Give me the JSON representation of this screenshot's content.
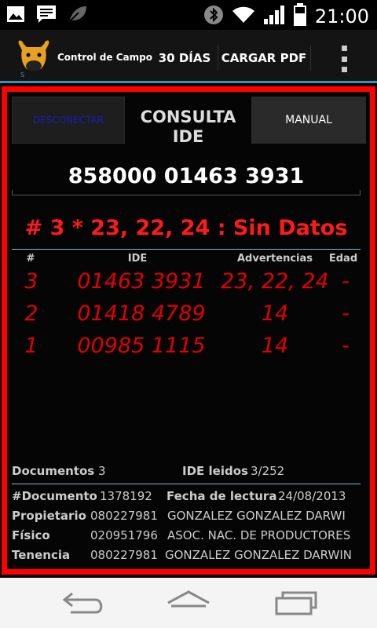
{
  "status_bar": {
    "time": "21:00",
    "icons": [
      "image-icon",
      "message-icon",
      "leaf-icon",
      "bluetooth-icon",
      "wifi-icon",
      "signal-icon",
      "battery-icon"
    ]
  },
  "action_bar": {
    "title": "Control de Campo",
    "btn_30_dias": "30 DÍAS",
    "btn_cargar_pdf": "CARGAR PDF"
  },
  "main": {
    "btn_desconectar": "DESCONECTAR",
    "consulta_line1": "CONSULTA",
    "consulta_line2": "IDE",
    "btn_manual": "MANUAL",
    "ide_value": "858000 01463 3931",
    "result": "# 3 * 23, 22, 24 : Sin Datos",
    "table": {
      "headers": [
        "#",
        "IDE",
        "Advertencias",
        "Edad"
      ],
      "rows": [
        {
          "num": "3",
          "ide": "01463 3931",
          "adv": "23, 22, 24",
          "edad": "-"
        },
        {
          "num": "2",
          "ide": "01418 4789",
          "adv": "14",
          "edad": "-"
        },
        {
          "num": "1",
          "ide": "00985 1115",
          "adv": "14",
          "edad": "-"
        }
      ]
    },
    "stats": {
      "documentos_label": "Documentos",
      "documentos_value": "3",
      "ide_leidos_label": "IDE leidos",
      "ide_leidos_value": "3/252"
    },
    "info": {
      "documento_label": "#Documento",
      "documento_value": "1378192",
      "fecha_label": "Fecha de lectura",
      "fecha_value": "24/08/2013",
      "propietario_label": "Propietario",
      "propietario_code": "080227981",
      "propietario_name": "GONZALEZ GONZALEZ DARWI",
      "fisico_label": "Físico",
      "fisico_code": "020951796",
      "fisico_name": "ASOC. NAC. DE PRODUCTORES",
      "tenencia_label": "Tenencia",
      "tenencia_code": "080227981",
      "tenencia_name": "GONZALEZ GONZALEZ DARWIN"
    }
  },
  "colors": {
    "accent": "#3a8fb7",
    "alert_red": "#ff1a1a",
    "frame_red": "#ff0000"
  }
}
